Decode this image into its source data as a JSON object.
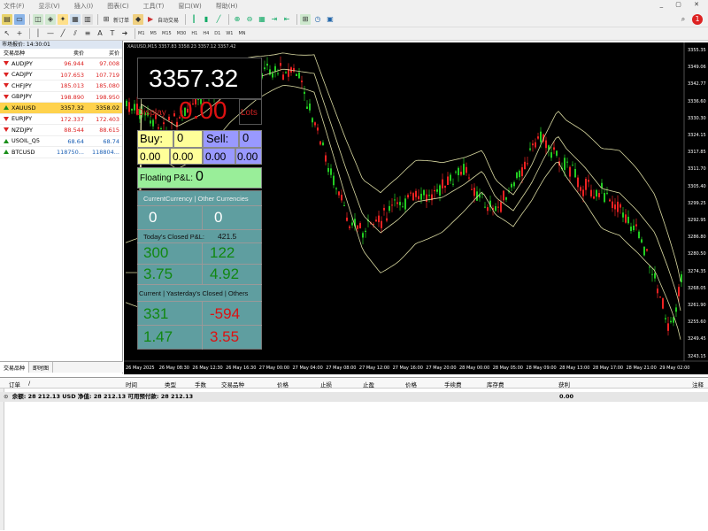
{
  "window": {
    "menu": [
      "文件(F)",
      "显示(V)",
      "插入(I)",
      "图表(C)",
      "工具(T)",
      "窗口(W)",
      "帮助(H)"
    ],
    "new_order": "新订单",
    "auto_trading": "自动交易"
  },
  "timeframes": [
    "M1",
    "M5",
    "M15",
    "M30",
    "H1",
    "H4",
    "D1",
    "W1",
    "MN"
  ],
  "market_watch": {
    "title": "市场报价: 14:30:01",
    "headers": {
      "symbol": "交易品种",
      "bid": "卖价",
      "ask": "买价"
    },
    "rows": [
      {
        "symbol": "AUDJPY",
        "bid": "96.944",
        "ask": "97.008",
        "dir": "down"
      },
      {
        "symbol": "CADJPY",
        "bid": "107.653",
        "ask": "107.719",
        "dir": "down"
      },
      {
        "symbol": "CHFJPY",
        "bid": "185.013",
        "ask": "185.080",
        "dir": "down"
      },
      {
        "symbol": "GBPJPY",
        "bid": "198.890",
        "ask": "198.950",
        "dir": "down"
      },
      {
        "symbol": "XAUUSD",
        "bid": "3357.32",
        "ask": "3358.02",
        "dir": "up",
        "selected": true
      },
      {
        "symbol": "EURJPY",
        "bid": "172.337",
        "ask": "172.403",
        "dir": "down"
      },
      {
        "symbol": "NZDJPY",
        "bid": "88.544",
        "ask": "88.615",
        "dir": "down"
      },
      {
        "symbol": "USOIL_Q5",
        "bid": "68.64",
        "ask": "68.74",
        "dir": "up"
      },
      {
        "symbol": "BTCUSD",
        "bid": "118750...",
        "ask": "118804...",
        "dir": "up"
      }
    ],
    "tabs": [
      "交易品种",
      "即时图"
    ]
  },
  "chart": {
    "header": "XAUUSD,M15  3357.83 3358.23 3357.12 3357.42",
    "price_axis": [
      "3355.35",
      "3349.06",
      "3342.77",
      "3336.60",
      "3330.30",
      "3324.15",
      "3317.85",
      "3311.70",
      "3305.40",
      "3299.25",
      "3292.95",
      "3286.80",
      "3280.50",
      "3274.35",
      "3268.05",
      "3261.90",
      "3255.60",
      "3249.45",
      "3243.15"
    ],
    "time_axis": [
      "26 May 2025",
      "26 May 08:30",
      "26 May 12:30",
      "26 May 16:30",
      "27 May 00:00",
      "27 May 04:00",
      "27 May 08:00",
      "27 May 12:00",
      "27 May 16:00",
      "27 May 20:00",
      "28 May 00:00",
      "28 May 05:00",
      "28 May 09:00",
      "28 May 13:00",
      "28 May 17:00",
      "28 May 21:00",
      "29 May 02:00"
    ]
  },
  "panel": {
    "price": "3357.32",
    "display_label": "Display",
    "display_value": "0.00",
    "lots_label": "Lots",
    "buy_label": "Buy:",
    "buy_value": "0",
    "sell_label": "Sell:",
    "sell_value": "0",
    "buy_a": "0.00",
    "buy_b": "0.00",
    "sell_a": "0.00",
    "sell_b": "0.00",
    "floating_label": "Floating P&L:",
    "floating_value": "0",
    "cc_header": "CurrentCurrency   |   Other Currencies",
    "cc_value": "0",
    "oc_value": "0",
    "closed_label": "Today's Closed P&L:",
    "closed_value": "421.5",
    "t1": "300",
    "t2": "122",
    "t3": "3.75",
    "t4": "4.92",
    "y_header": "Current  |  Yasterday's Closed  |  Others",
    "y1": "331",
    "y2": "-594",
    "y3": "1.47",
    "y4": "3.55"
  },
  "terminal": {
    "headers": [
      "订单",
      "/",
      "时间",
      "类型",
      "手数",
      "交易品种",
      "价格",
      "止损",
      "止盈",
      "价格",
      "手续费",
      "库存费",
      "获利",
      "注释"
    ],
    "balance": "余额: 28 212.13 USD  净值: 28 212.13  可用预付款: 28 212.13",
    "profit": "0.00"
  }
}
